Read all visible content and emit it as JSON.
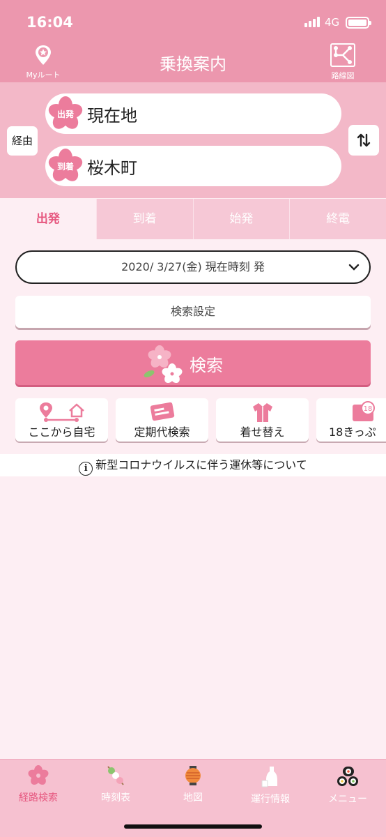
{
  "status": {
    "time": "16:04",
    "network": "4G"
  },
  "header": {
    "title": "乗換案内",
    "myroute_label": "Myルート",
    "routemap_label": "路線図"
  },
  "stations": {
    "from_badge": "出発",
    "from_name": "現在地",
    "to_badge": "到着",
    "to_name": "桜木町",
    "via_label": "経由",
    "swap_icon": "swap-vertical-icon"
  },
  "tabs": [
    {
      "label": "出発",
      "active": true
    },
    {
      "label": "到着",
      "active": false
    },
    {
      "label": "始発",
      "active": false
    },
    {
      "label": "終電",
      "active": false
    }
  ],
  "date_select": {
    "value": "2020/ 3/27(金) 現在時刻 発"
  },
  "settings_label": "検索設定",
  "search_label": "検索",
  "quick_buttons": [
    {
      "label": "ここから自宅",
      "icon": "route-home-icon"
    },
    {
      "label": "定期代検索",
      "icon": "commuter-pass-icon"
    },
    {
      "label": "着せ替え",
      "icon": "shirt-icon"
    },
    {
      "label": "18きっぷ",
      "icon": "ticket-18-icon"
    }
  ],
  "notice": {
    "text": "新型コロナウイルスに伴う運休等について"
  },
  "bottom_nav": [
    {
      "label": "経路検索",
      "icon": "sakura-icon",
      "active": true
    },
    {
      "label": "時刻表",
      "icon": "dango-icon",
      "active": false
    },
    {
      "label": "地図",
      "icon": "lantern-icon",
      "active": false
    },
    {
      "label": "運行情報",
      "icon": "sake-icon",
      "active": false
    },
    {
      "label": "メニュー",
      "icon": "sushi-icon",
      "active": false
    }
  ],
  "colors": {
    "header": "#ec97ae",
    "accent": "#e6577f",
    "search_button": "#ec7c9c",
    "panel": "#f3b8c8"
  }
}
